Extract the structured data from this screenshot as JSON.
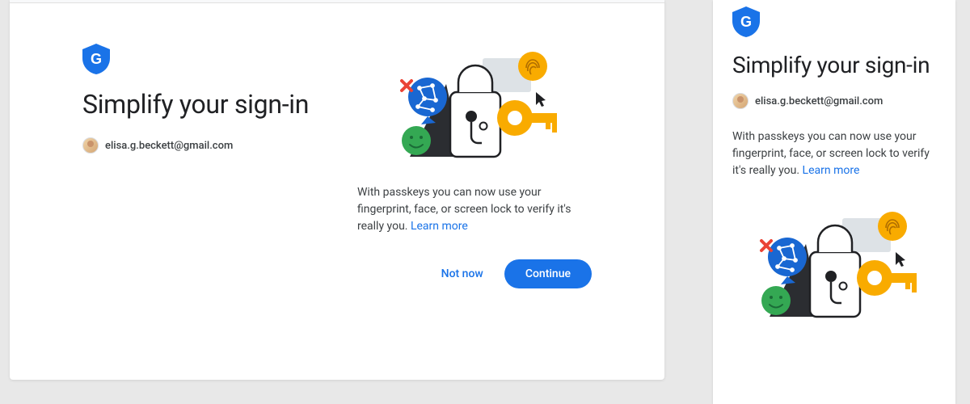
{
  "heading": "Simplify your sign-in",
  "account_email": "elisa.g.beckett@gmail.com",
  "description": "With passkeys you can now use your fingerprint, face, or screen lock to verify it's really you.",
  "learn_more_label": "Learn more",
  "buttons": {
    "not_now": "Not now",
    "continue": "Continue"
  }
}
